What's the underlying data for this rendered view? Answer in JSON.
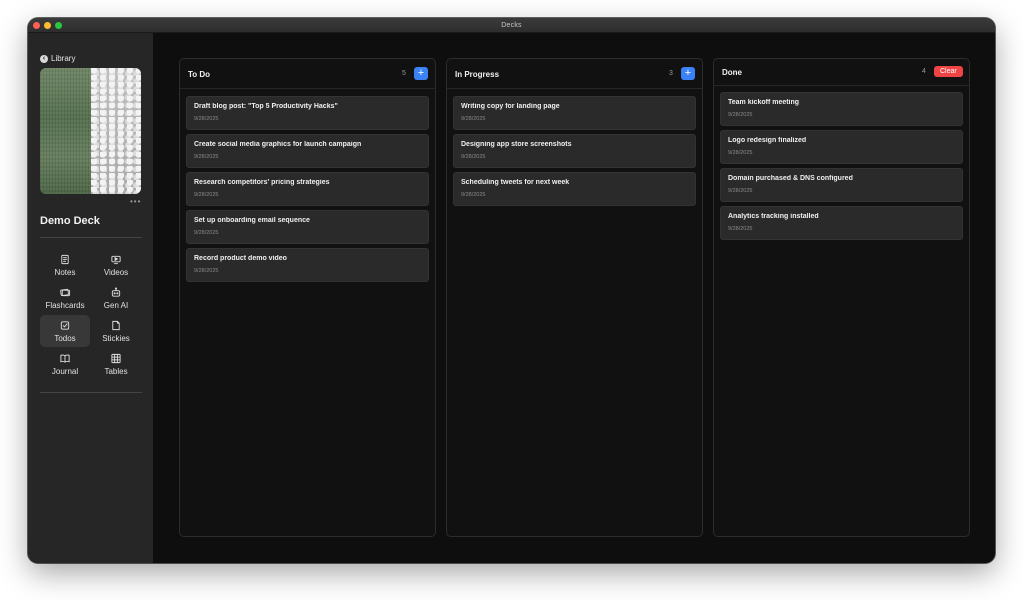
{
  "window": {
    "title": "Decks"
  },
  "sidebar": {
    "back_label": "Library",
    "more_label": "•••",
    "deck_name": "Demo Deck",
    "nav": [
      {
        "label": "Notes",
        "icon": "notes-icon"
      },
      {
        "label": "Videos",
        "icon": "videos-icon"
      },
      {
        "label": "Flashcards",
        "icon": "flashcards-icon"
      },
      {
        "label": "Gen AI",
        "icon": "robot-icon"
      },
      {
        "label": "Todos",
        "icon": "checkbox-icon",
        "active": true
      },
      {
        "label": "Stickies",
        "icon": "sticky-note-icon"
      },
      {
        "label": "Journal",
        "icon": "book-icon"
      },
      {
        "label": "Tables",
        "icon": "table-icon"
      }
    ]
  },
  "board": {
    "columns": [
      {
        "title": "To Do",
        "count": "5",
        "action": "+",
        "cards": [
          {
            "title": "Draft blog post: \"Top 5 Productivity Hacks\"",
            "date": "9/28/2025"
          },
          {
            "title": "Create social media graphics for launch campaign",
            "date": "9/28/2025"
          },
          {
            "title": "Research competitors' pricing strategies",
            "date": "9/28/2025"
          },
          {
            "title": "Set up onboarding email sequence",
            "date": "9/28/2025"
          },
          {
            "title": "Record product demo video",
            "date": "9/28/2025"
          }
        ]
      },
      {
        "title": "In Progress",
        "count": "3",
        "action": "+",
        "cards": [
          {
            "title": "Writing copy for landing page",
            "date": "9/28/2025"
          },
          {
            "title": "Designing app store screenshots",
            "date": "9/28/2025"
          },
          {
            "title": "Scheduling tweets for next week",
            "date": "9/28/2025"
          }
        ]
      },
      {
        "title": "Done",
        "count": "4",
        "action": "Clear",
        "cards": [
          {
            "title": "Team kickoff meeting",
            "date": "9/28/2025"
          },
          {
            "title": "Logo redesign finalized",
            "date": "9/28/2025"
          },
          {
            "title": "Domain purchased & DNS configured",
            "date": "9/28/2025"
          },
          {
            "title": "Analytics tracking installed",
            "date": "9/28/2025"
          }
        ]
      }
    ]
  },
  "colors": {
    "accent": "#3b82f6",
    "danger": "#ef4444",
    "background": "#0e0e0e",
    "sidebar": "#262626",
    "card": "#2a2a2a"
  }
}
